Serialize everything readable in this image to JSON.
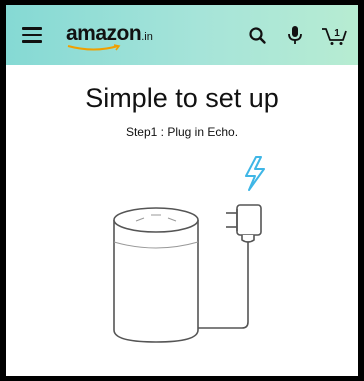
{
  "header": {
    "logo_text": "amazon",
    "logo_suffix": ".in",
    "icons": [
      "menu-icon",
      "search-icon",
      "mic-icon",
      "cart-icon"
    ],
    "cart_count": "1"
  },
  "content": {
    "title": "Simple to set up",
    "step_text": "Step1 : Plug in Echo."
  },
  "colors": {
    "header_gradient_start": "#85d9d4",
    "header_gradient_end": "#b7ecd2",
    "accent_bolt": "#3fb6e6",
    "logo_smile": "#f0a000"
  }
}
